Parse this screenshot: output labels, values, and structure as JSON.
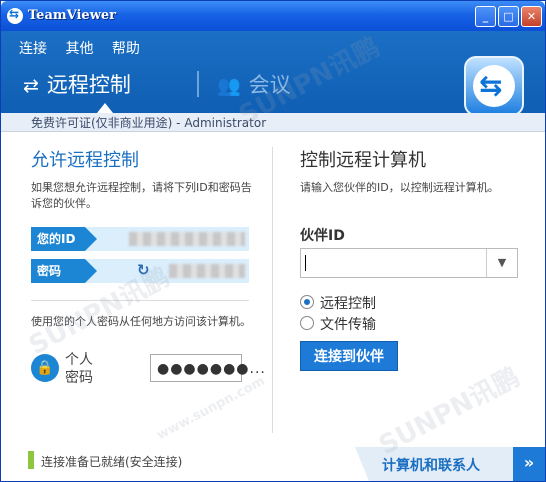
{
  "window": {
    "title": "TeamViewer",
    "controls": [
      "_",
      "□",
      "✕"
    ]
  },
  "menu": [
    "连接",
    "其他",
    "帮助"
  ],
  "tabs": {
    "remote": "远程控制",
    "meeting": "会议"
  },
  "license": "免费许可证(仅非商业用途) - Administrator",
  "left": {
    "heading": "允许远程控制",
    "description": "如果您想允许远程控制，请将下列ID和密码告诉您的伙伴。",
    "id_label": "您的ID",
    "pwd_label": "密码",
    "personal_desc": "使用您的个人密码从任何地方访问该计算机。",
    "personal_label_1": "个人",
    "personal_label_2": "密码",
    "personal_pwd_value": "●●●●●●●..."
  },
  "right": {
    "heading": "控制远程计算机",
    "description": "请输入您伙伴的ID，以控制远程计算机。",
    "partner_id_label": "伙伴ID",
    "partner_id_value": "",
    "option_remote": "远程控制",
    "option_file": "文件传输",
    "connect_button": "连接到伙伴"
  },
  "status": {
    "text": "连接准备已就绪(安全连接)",
    "contacts_label": "计算机和联系人",
    "contacts_button": "»"
  },
  "watermark": [
    "SUNPN讯鹏",
    "www.sunpn.com"
  ],
  "colors": {
    "brand_blue": "#1d7ad6",
    "header": "#1b6fc4",
    "ready": "#8ec63f"
  }
}
